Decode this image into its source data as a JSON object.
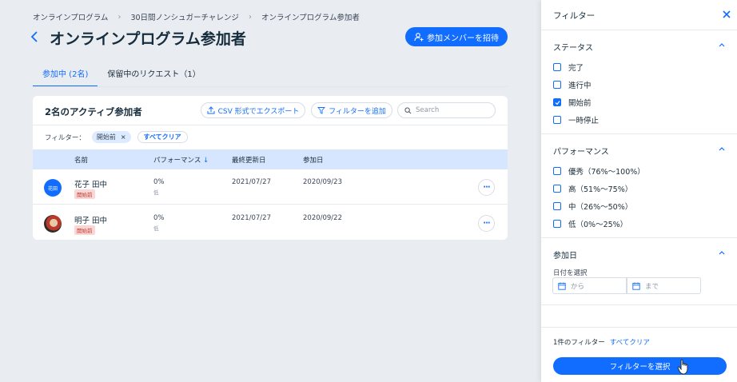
{
  "breadcrumb": [
    "オンラインプログラム",
    "30日間ノンシュガーチャレンジ",
    "オンラインプログラム参加者"
  ],
  "page": {
    "title": "オンラインプログラム参加者",
    "invite_label": "参加メンバーを招待"
  },
  "tabs": [
    {
      "label": "参加中 (2名)",
      "active": true
    },
    {
      "label": "保留中のリクエスト（1）",
      "active": false
    }
  ],
  "card": {
    "title": "2名のアクティブ参加者",
    "export_label": "CSV 形式でエクスポート",
    "add_filter_label": "フィルターを追加",
    "search_placeholder": "Search",
    "filter_label": "フィルター：",
    "active_chip": "開始前",
    "clear_all": "すべてクリア"
  },
  "table": {
    "columns": [
      "名前",
      "パフォーマンス",
      "最終更新日",
      "参加日"
    ],
    "sort_indicator": "↓",
    "rows": [
      {
        "avatar_text": "花田",
        "name": "花子 田中",
        "badge": "開始前",
        "performance": "0%",
        "performance_label": "低",
        "last_updated": "2021/07/27",
        "joined": "2020/09/23"
      },
      {
        "avatar_text": "",
        "name": "明子 田中",
        "badge": "開始前",
        "performance": "0%",
        "performance_label": "低",
        "last_updated": "2021/07/27",
        "joined": "2020/09/22"
      }
    ]
  },
  "panel": {
    "title": "フィルター",
    "status": {
      "title": "ステータス",
      "options": [
        {
          "label": "完了",
          "checked": false
        },
        {
          "label": "進行中",
          "checked": false
        },
        {
          "label": "開始前",
          "checked": true
        },
        {
          "label": "一時停止",
          "checked": false
        }
      ]
    },
    "performance": {
      "title": "パフォーマンス",
      "options": [
        {
          "label": "優秀（76%〜100%）",
          "checked": false
        },
        {
          "label": "高（51%〜75%）",
          "checked": false
        },
        {
          "label": "中（26%〜50%）",
          "checked": false
        },
        {
          "label": "低（0%〜25%）",
          "checked": false
        }
      ]
    },
    "join_date": {
      "title": "参加日",
      "label": "日付を選択",
      "from_placeholder": "から",
      "to_placeholder": "まで"
    },
    "footer": {
      "count_text": "1件のフィルター",
      "clear_all": "すべてクリア",
      "apply_label": "フィルターを選択"
    }
  },
  "colors": {
    "accent": "#116dff",
    "badge_bg": "#fbd6d6",
    "header_row": "#d6e6fe"
  }
}
